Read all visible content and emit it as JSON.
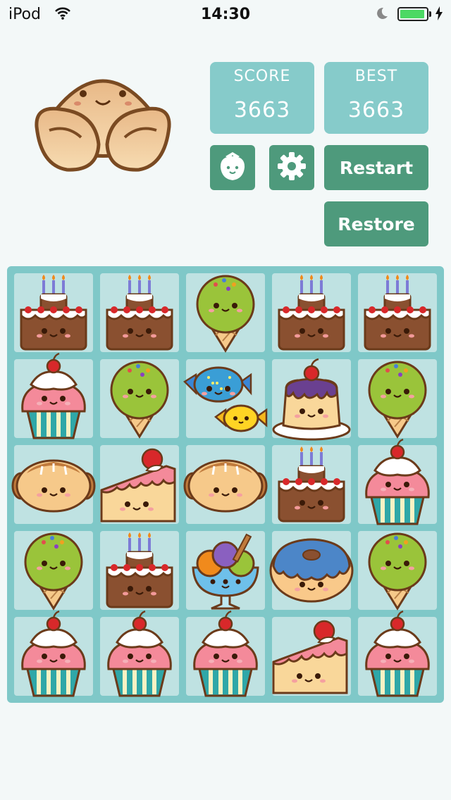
{
  "status_bar": {
    "carrier": "iPod",
    "time": "14:30",
    "battery_level": 0.95
  },
  "header": {
    "mascot": "croissant-mascot",
    "score": {
      "label": "SCORE",
      "value": "3663"
    },
    "best": {
      "label": "BEST",
      "value": "3663"
    },
    "buttons": {
      "strawberry_icon": "strawberry-icon",
      "settings_icon": "gear-icon",
      "restart_label": "Restart",
      "restore_label": "Restore"
    }
  },
  "board": {
    "rows": 5,
    "cols": 5,
    "tiles": [
      [
        "birthday-cake",
        "birthday-cake",
        "ice-cream-cone",
        "birthday-cake",
        "birthday-cake"
      ],
      [
        "cupcake",
        "ice-cream-cone",
        "candy",
        "pudding",
        "ice-cream-cone"
      ],
      [
        "bread",
        "cake-slice",
        "bread",
        "birthday-cake",
        "cupcake"
      ],
      [
        "ice-cream-cone",
        "birthday-cake",
        "sundae",
        "donut",
        "ice-cream-cone"
      ],
      [
        "cupcake",
        "cupcake",
        "cupcake",
        "cake-slice",
        "cupcake"
      ]
    ]
  },
  "colors": {
    "background": "#f3f8f8",
    "score_box": "#86cbca",
    "button": "#4e9a7c",
    "board": "#7fc8c8",
    "cell": "#bfe2e2"
  }
}
